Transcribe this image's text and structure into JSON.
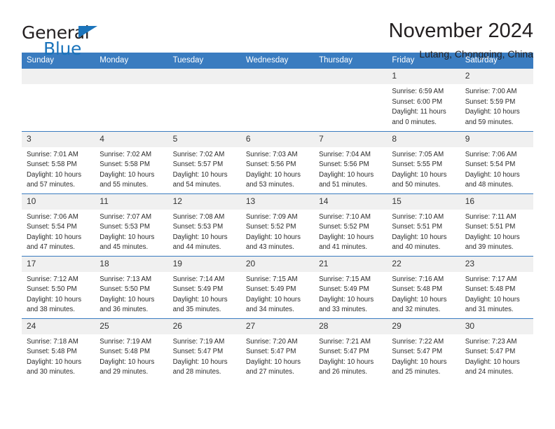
{
  "brand": {
    "name_part1": "General",
    "name_part2": "Blue",
    "triangle_icon": "triangle-icon",
    "accent_color": "#1b74bb"
  },
  "header": {
    "title": "November 2024",
    "subtitle": "Lutang, Chongqing, China"
  },
  "calendar": {
    "header_bg": "#3a7cc0",
    "daynum_bg": "#f0f0f0",
    "weekdays": [
      "Sunday",
      "Monday",
      "Tuesday",
      "Wednesday",
      "Thursday",
      "Friday",
      "Saturday"
    ],
    "labels": {
      "sunrise": "Sunrise:",
      "sunset": "Sunset:",
      "daylight": "Daylight:"
    },
    "weeks": [
      [
        {
          "day": ""
        },
        {
          "day": ""
        },
        {
          "day": ""
        },
        {
          "day": ""
        },
        {
          "day": ""
        },
        {
          "day": "1",
          "sunrise": "Sunrise: 6:59 AM",
          "sunset": "Sunset: 6:00 PM",
          "daylight_1": "Daylight: 11 hours",
          "daylight_2": "and 0 minutes."
        },
        {
          "day": "2",
          "sunrise": "Sunrise: 7:00 AM",
          "sunset": "Sunset: 5:59 PM",
          "daylight_1": "Daylight: 10 hours",
          "daylight_2": "and 59 minutes."
        }
      ],
      [
        {
          "day": "3",
          "sunrise": "Sunrise: 7:01 AM",
          "sunset": "Sunset: 5:58 PM",
          "daylight_1": "Daylight: 10 hours",
          "daylight_2": "and 57 minutes."
        },
        {
          "day": "4",
          "sunrise": "Sunrise: 7:02 AM",
          "sunset": "Sunset: 5:58 PM",
          "daylight_1": "Daylight: 10 hours",
          "daylight_2": "and 55 minutes."
        },
        {
          "day": "5",
          "sunrise": "Sunrise: 7:02 AM",
          "sunset": "Sunset: 5:57 PM",
          "daylight_1": "Daylight: 10 hours",
          "daylight_2": "and 54 minutes."
        },
        {
          "day": "6",
          "sunrise": "Sunrise: 7:03 AM",
          "sunset": "Sunset: 5:56 PM",
          "daylight_1": "Daylight: 10 hours",
          "daylight_2": "and 53 minutes."
        },
        {
          "day": "7",
          "sunrise": "Sunrise: 7:04 AM",
          "sunset": "Sunset: 5:56 PM",
          "daylight_1": "Daylight: 10 hours",
          "daylight_2": "and 51 minutes."
        },
        {
          "day": "8",
          "sunrise": "Sunrise: 7:05 AM",
          "sunset": "Sunset: 5:55 PM",
          "daylight_1": "Daylight: 10 hours",
          "daylight_2": "and 50 minutes."
        },
        {
          "day": "9",
          "sunrise": "Sunrise: 7:06 AM",
          "sunset": "Sunset: 5:54 PM",
          "daylight_1": "Daylight: 10 hours",
          "daylight_2": "and 48 minutes."
        }
      ],
      [
        {
          "day": "10",
          "sunrise": "Sunrise: 7:06 AM",
          "sunset": "Sunset: 5:54 PM",
          "daylight_1": "Daylight: 10 hours",
          "daylight_2": "and 47 minutes."
        },
        {
          "day": "11",
          "sunrise": "Sunrise: 7:07 AM",
          "sunset": "Sunset: 5:53 PM",
          "daylight_1": "Daylight: 10 hours",
          "daylight_2": "and 45 minutes."
        },
        {
          "day": "12",
          "sunrise": "Sunrise: 7:08 AM",
          "sunset": "Sunset: 5:53 PM",
          "daylight_1": "Daylight: 10 hours",
          "daylight_2": "and 44 minutes."
        },
        {
          "day": "13",
          "sunrise": "Sunrise: 7:09 AM",
          "sunset": "Sunset: 5:52 PM",
          "daylight_1": "Daylight: 10 hours",
          "daylight_2": "and 43 minutes."
        },
        {
          "day": "14",
          "sunrise": "Sunrise: 7:10 AM",
          "sunset": "Sunset: 5:52 PM",
          "daylight_1": "Daylight: 10 hours",
          "daylight_2": "and 41 minutes."
        },
        {
          "day": "15",
          "sunrise": "Sunrise: 7:10 AM",
          "sunset": "Sunset: 5:51 PM",
          "daylight_1": "Daylight: 10 hours",
          "daylight_2": "and 40 minutes."
        },
        {
          "day": "16",
          "sunrise": "Sunrise: 7:11 AM",
          "sunset": "Sunset: 5:51 PM",
          "daylight_1": "Daylight: 10 hours",
          "daylight_2": "and 39 minutes."
        }
      ],
      [
        {
          "day": "17",
          "sunrise": "Sunrise: 7:12 AM",
          "sunset": "Sunset: 5:50 PM",
          "daylight_1": "Daylight: 10 hours",
          "daylight_2": "and 38 minutes."
        },
        {
          "day": "18",
          "sunrise": "Sunrise: 7:13 AM",
          "sunset": "Sunset: 5:50 PM",
          "daylight_1": "Daylight: 10 hours",
          "daylight_2": "and 36 minutes."
        },
        {
          "day": "19",
          "sunrise": "Sunrise: 7:14 AM",
          "sunset": "Sunset: 5:49 PM",
          "daylight_1": "Daylight: 10 hours",
          "daylight_2": "and 35 minutes."
        },
        {
          "day": "20",
          "sunrise": "Sunrise: 7:15 AM",
          "sunset": "Sunset: 5:49 PM",
          "daylight_1": "Daylight: 10 hours",
          "daylight_2": "and 34 minutes."
        },
        {
          "day": "21",
          "sunrise": "Sunrise: 7:15 AM",
          "sunset": "Sunset: 5:49 PM",
          "daylight_1": "Daylight: 10 hours",
          "daylight_2": "and 33 minutes."
        },
        {
          "day": "22",
          "sunrise": "Sunrise: 7:16 AM",
          "sunset": "Sunset: 5:48 PM",
          "daylight_1": "Daylight: 10 hours",
          "daylight_2": "and 32 minutes."
        },
        {
          "day": "23",
          "sunrise": "Sunrise: 7:17 AM",
          "sunset": "Sunset: 5:48 PM",
          "daylight_1": "Daylight: 10 hours",
          "daylight_2": "and 31 minutes."
        }
      ],
      [
        {
          "day": "24",
          "sunrise": "Sunrise: 7:18 AM",
          "sunset": "Sunset: 5:48 PM",
          "daylight_1": "Daylight: 10 hours",
          "daylight_2": "and 30 minutes."
        },
        {
          "day": "25",
          "sunrise": "Sunrise: 7:19 AM",
          "sunset": "Sunset: 5:48 PM",
          "daylight_1": "Daylight: 10 hours",
          "daylight_2": "and 29 minutes."
        },
        {
          "day": "26",
          "sunrise": "Sunrise: 7:19 AM",
          "sunset": "Sunset: 5:47 PM",
          "daylight_1": "Daylight: 10 hours",
          "daylight_2": "and 28 minutes."
        },
        {
          "day": "27",
          "sunrise": "Sunrise: 7:20 AM",
          "sunset": "Sunset: 5:47 PM",
          "daylight_1": "Daylight: 10 hours",
          "daylight_2": "and 27 minutes."
        },
        {
          "day": "28",
          "sunrise": "Sunrise: 7:21 AM",
          "sunset": "Sunset: 5:47 PM",
          "daylight_1": "Daylight: 10 hours",
          "daylight_2": "and 26 minutes."
        },
        {
          "day": "29",
          "sunrise": "Sunrise: 7:22 AM",
          "sunset": "Sunset: 5:47 PM",
          "daylight_1": "Daylight: 10 hours",
          "daylight_2": "and 25 minutes."
        },
        {
          "day": "30",
          "sunrise": "Sunrise: 7:23 AM",
          "sunset": "Sunset: 5:47 PM",
          "daylight_1": "Daylight: 10 hours",
          "daylight_2": "and 24 minutes."
        }
      ]
    ]
  }
}
